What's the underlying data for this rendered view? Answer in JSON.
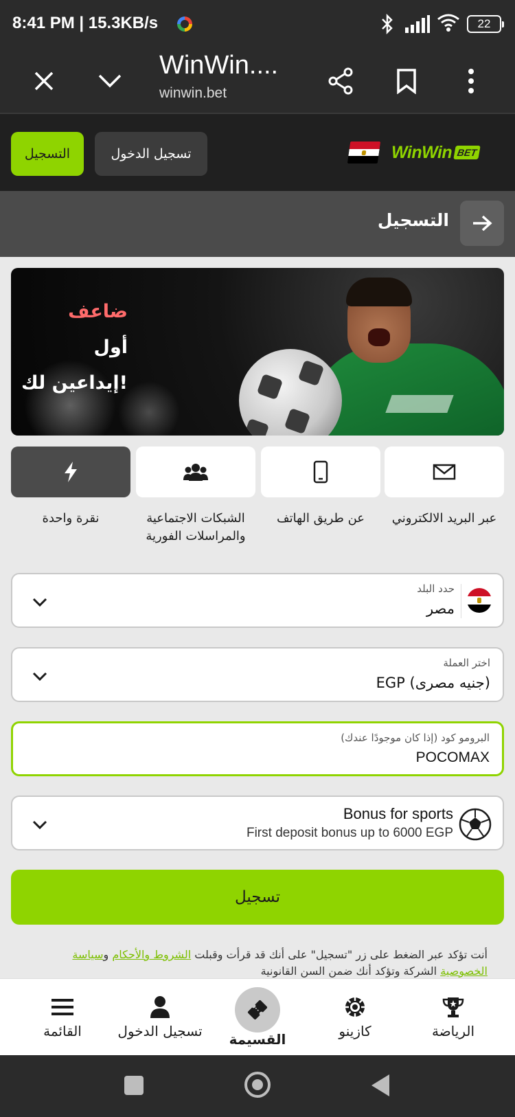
{
  "status_bar": {
    "time": "8:41 PM | 15.3KB/s",
    "battery": "22",
    "bluetooth_glyph": "✱"
  },
  "browser": {
    "title": "WinWin....",
    "url": "winwin.bet"
  },
  "site_header": {
    "register_label": "التسجيل",
    "login_label": "تسجيل الدخول",
    "logo_text": "WinWin",
    "logo_badge": "BET",
    "brand_color": "#8fd400"
  },
  "page": {
    "title": "التسجيل"
  },
  "banner": {
    "line1": "ضاعف",
    "line2": "أول",
    "line3": "إيداعين لك!"
  },
  "methods": [
    {
      "label": "عبر البريد الالكتروني",
      "icon": "envelope-icon"
    },
    {
      "label": "عن طريق الهاتف",
      "icon": "phone-icon"
    },
    {
      "label": "الشبكات الاجتماعية والمراسلات الفورية",
      "icon": "people-icon"
    },
    {
      "label": "نقرة واحدة",
      "icon": "lightning-icon",
      "active": true
    }
  ],
  "form": {
    "country": {
      "label": "حدد البلد",
      "value": "مصر"
    },
    "currency": {
      "label": "اختر العملة",
      "value": "EGP (جنيه مصرى)"
    },
    "promo": {
      "label": "البرومو كود (إذا كان موجودًا عندك)",
      "value": "POCOMAX"
    },
    "bonus": {
      "title": "Bonus for sports",
      "subtitle": "First deposit bonus up to 6000 EGP"
    },
    "submit_label": "تسجيل"
  },
  "terms": {
    "before": "أنت تؤكد عبر الضغط على زر \"تسجيل\" على أنك قد قرأت وقبلت ",
    "terms_link": "الشروط والأحكام",
    "and": " و",
    "privacy_link": "سياسة الخصوصية",
    "after": " الشركة وتؤكد أنك ضمن السن القانونية"
  },
  "bottom_nav": {
    "sports": "الرياضة",
    "casino": "كازينو",
    "coupon": "القسيمة",
    "login": "تسجيل الدخول",
    "menu": "القائمة"
  }
}
